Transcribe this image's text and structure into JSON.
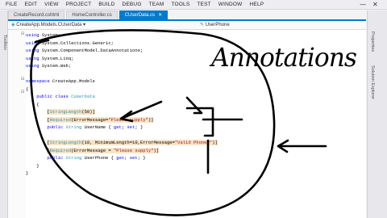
{
  "menu": [
    "FILE",
    "EDIT",
    "VIEW",
    "PROJECT",
    "BUILD",
    "DEBUG",
    "TEAM",
    "TOOLS",
    "TEST",
    "WINDOW",
    "HELP"
  ],
  "window_buttons": {
    "minimize": "—",
    "close": "✕"
  },
  "tabs": [
    {
      "label": "CreateRecord.cshtml",
      "active": false
    },
    {
      "label": "HomeController.cs",
      "active": false
    },
    {
      "label": "CUserData.cs",
      "active": true,
      "close": "✕"
    }
  ],
  "nav": {
    "left": "CreateApp.Models.CUserData",
    "right": "UserPhone"
  },
  "left_panel": {
    "label": "Toolbox"
  },
  "right_panel": {
    "labels": [
      "Properties",
      "Solution Explorer"
    ]
  },
  "code": [
    {
      "indent": "",
      "parts": [
        {
          "t": "using",
          "c": "kw"
        },
        {
          "t": " System;"
        }
      ]
    },
    {
      "indent": "",
      "parts": [
        {
          "t": "using",
          "c": "kw"
        },
        {
          "t": " System.Collections.Generic;"
        }
      ]
    },
    {
      "indent": "",
      "parts": [
        {
          "t": "using",
          "c": "kw"
        },
        {
          "t": " System.ComponentModel.DataAnnotations;"
        }
      ]
    },
    {
      "indent": "",
      "parts": [
        {
          "t": "using",
          "c": "kw"
        },
        {
          "t": " System.Linq;"
        }
      ]
    },
    {
      "indent": "",
      "parts": [
        {
          "t": "using",
          "c": "kw"
        },
        {
          "t": " System.Web;"
        }
      ]
    },
    {
      "indent": "",
      "parts": []
    },
    {
      "indent": "",
      "parts": [
        {
          "t": "namespace",
          "c": "kw"
        },
        {
          "t": " CreateApp.Models"
        }
      ]
    },
    {
      "indent": "",
      "parts": [
        {
          "t": "{"
        }
      ]
    },
    {
      "indent": "    ",
      "parts": [
        {
          "t": "public",
          "c": "kw"
        },
        {
          "t": " "
        },
        {
          "t": "class",
          "c": "kw"
        },
        {
          "t": " "
        },
        {
          "t": "CUserData",
          "c": "ty"
        }
      ]
    },
    {
      "indent": "    ",
      "parts": [
        {
          "t": "{"
        }
      ]
    },
    {
      "indent": "        ",
      "parts": [
        {
          "t": "[",
          "c": "attr"
        },
        {
          "t": "StringLength",
          "c": "ty attr"
        },
        {
          "t": "(50)]",
          "c": "attr"
        }
      ]
    },
    {
      "indent": "        ",
      "parts": [
        {
          "t": "[",
          "c": "attr"
        },
        {
          "t": "Required",
          "c": "ty attr"
        },
        {
          "t": "(ErrorMessage=",
          "c": "attr"
        },
        {
          "t": "\"Please supply\"",
          "c": "st attr"
        },
        {
          "t": ")]",
          "c": "attr"
        }
      ]
    },
    {
      "indent": "        ",
      "parts": [
        {
          "t": "public",
          "c": "kw"
        },
        {
          "t": " "
        },
        {
          "t": "String",
          "c": "ty"
        },
        {
          "t": " UserName { "
        },
        {
          "t": "get",
          "c": "kw"
        },
        {
          "t": "; "
        },
        {
          "t": "set",
          "c": "kw"
        },
        {
          "t": "; }"
        }
      ]
    },
    {
      "indent": "",
      "parts": []
    },
    {
      "indent": "        ",
      "parts": [
        {
          "t": "[",
          "c": "attr"
        },
        {
          "t": "StringLength",
          "c": "ty attr"
        },
        {
          "t": "(10, MinimumLength=10,ErrorMessage=",
          "c": "attr"
        },
        {
          "t": "\"Valid Phone?\"",
          "c": "st attr"
        },
        {
          "t": ")]",
          "c": "attr"
        }
      ]
    },
    {
      "indent": "        ",
      "parts": [
        {
          "t": "[",
          "c": "attr"
        },
        {
          "t": "Required",
          "c": "ty attr"
        },
        {
          "t": "(ErrorMessage = ",
          "c": "attr"
        },
        {
          "t": "\"Please supply\"",
          "c": "st attr"
        },
        {
          "t": ")]",
          "c": "attr"
        }
      ]
    },
    {
      "indent": "        ",
      "parts": [
        {
          "t": "public",
          "c": "kw"
        },
        {
          "t": " "
        },
        {
          "t": "String",
          "c": "ty"
        },
        {
          "t": " UserPhone { "
        },
        {
          "t": "get",
          "c": "kw"
        },
        {
          "t": "; "
        },
        {
          "t": "set",
          "c": "kw"
        },
        {
          "t": "; }"
        }
      ]
    },
    {
      "indent": "    ",
      "parts": [
        {
          "t": "}"
        }
      ]
    },
    {
      "indent": "",
      "parts": [
        {
          "t": "}"
        }
      ]
    }
  ],
  "handwriting": {
    "text": "Annotations"
  },
  "colors": {
    "accent": "#007acc",
    "keyword": "#0000ff",
    "type": "#2b91af",
    "string": "#a31515",
    "ink": "#000000"
  }
}
